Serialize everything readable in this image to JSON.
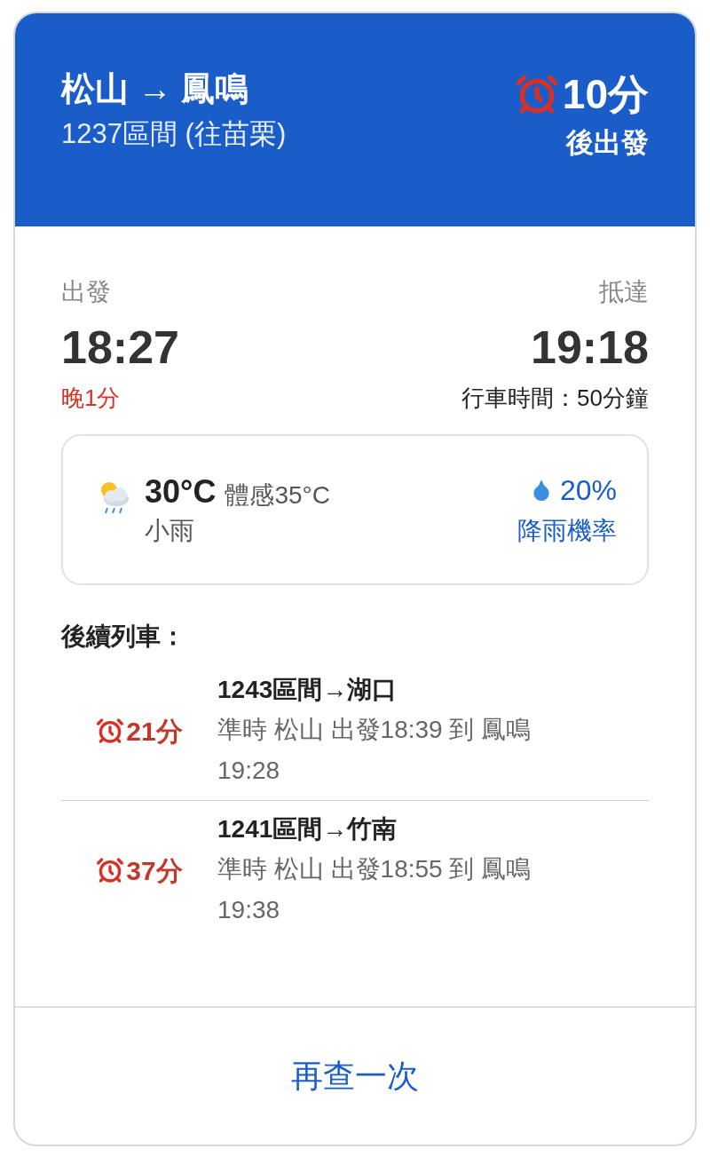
{
  "header": {
    "route": "松山 → 鳳鳴",
    "train": "1237區間 (往苗栗)",
    "countdown": "10分",
    "countdown_label": "後出發"
  },
  "departure": {
    "label": "出發",
    "time": "18:27",
    "delay": "晚1分"
  },
  "arrival": {
    "label": "抵達",
    "time": "19:18",
    "duration": "行車時間：50分鐘"
  },
  "weather": {
    "temperature": "30°C",
    "feels_like": "體感35°C",
    "condition": "小雨",
    "rain_chance": "20%",
    "rain_label": "降雨機率"
  },
  "next_trains": {
    "title": "後續列車：",
    "items": [
      {
        "countdown": "21分",
        "name": "1243區間→湖口",
        "detail": "準時 松山 出發18:39 到 鳳鳴 19:28"
      },
      {
        "countdown": "37分",
        "name": "1241區間→竹南",
        "detail": "準時 松山 出發18:55 到 鳳鳴 19:38"
      }
    ]
  },
  "action": {
    "label": "再查一次"
  }
}
